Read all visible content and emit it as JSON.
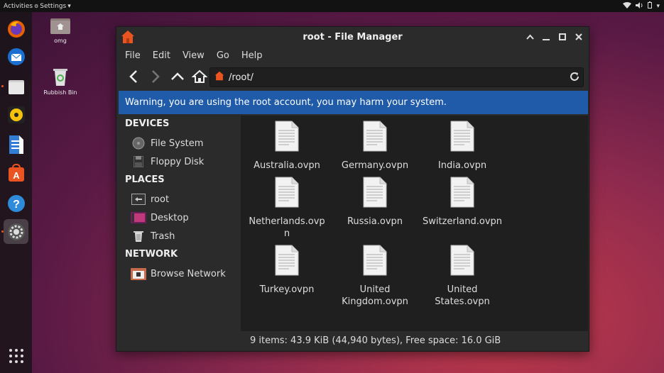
{
  "topbar": {
    "activities": "Activities",
    "app_menu": "Settings"
  },
  "desktop": {
    "icons": [
      {
        "label": "omg"
      },
      {
        "label": "Rubbish Bin"
      }
    ]
  },
  "window": {
    "title": "root - File Manager",
    "menu": [
      "File",
      "Edit",
      "View",
      "Go",
      "Help"
    ],
    "path": "/root/",
    "warning": "Warning, you are using the root account, you may harm your system.",
    "sidebar": {
      "devices_heading": "DEVICES",
      "devices": [
        "File System",
        "Floppy Disk"
      ],
      "places_heading": "PLACES",
      "places": [
        "root",
        "Desktop",
        "Trash"
      ],
      "network_heading": "NETWORK",
      "network": [
        "Browse Network"
      ]
    },
    "files": [
      {
        "line1": "Australia.ovpn",
        "line2": ""
      },
      {
        "line1": "Germany.ovpn",
        "line2": ""
      },
      {
        "line1": "India.ovpn",
        "line2": ""
      },
      {
        "line1": "Netherlands.ovp",
        "line2": "n"
      },
      {
        "line1": "Russia.ovpn",
        "line2": ""
      },
      {
        "line1": "Switzerland.ovpn",
        "line2": ""
      },
      {
        "line1": "Turkey.ovpn",
        "line2": ""
      },
      {
        "line1": "United",
        "line2": "Kingdom.ovpn"
      },
      {
        "line1": "United",
        "line2": "States.ovpn"
      }
    ],
    "status": "9 items: 43.9 KiB (44,940 bytes), Free space: 16.0 GiB"
  },
  "colors": {
    "accent": "#1f5ba8",
    "ubuntu_orange": "#e95420"
  }
}
